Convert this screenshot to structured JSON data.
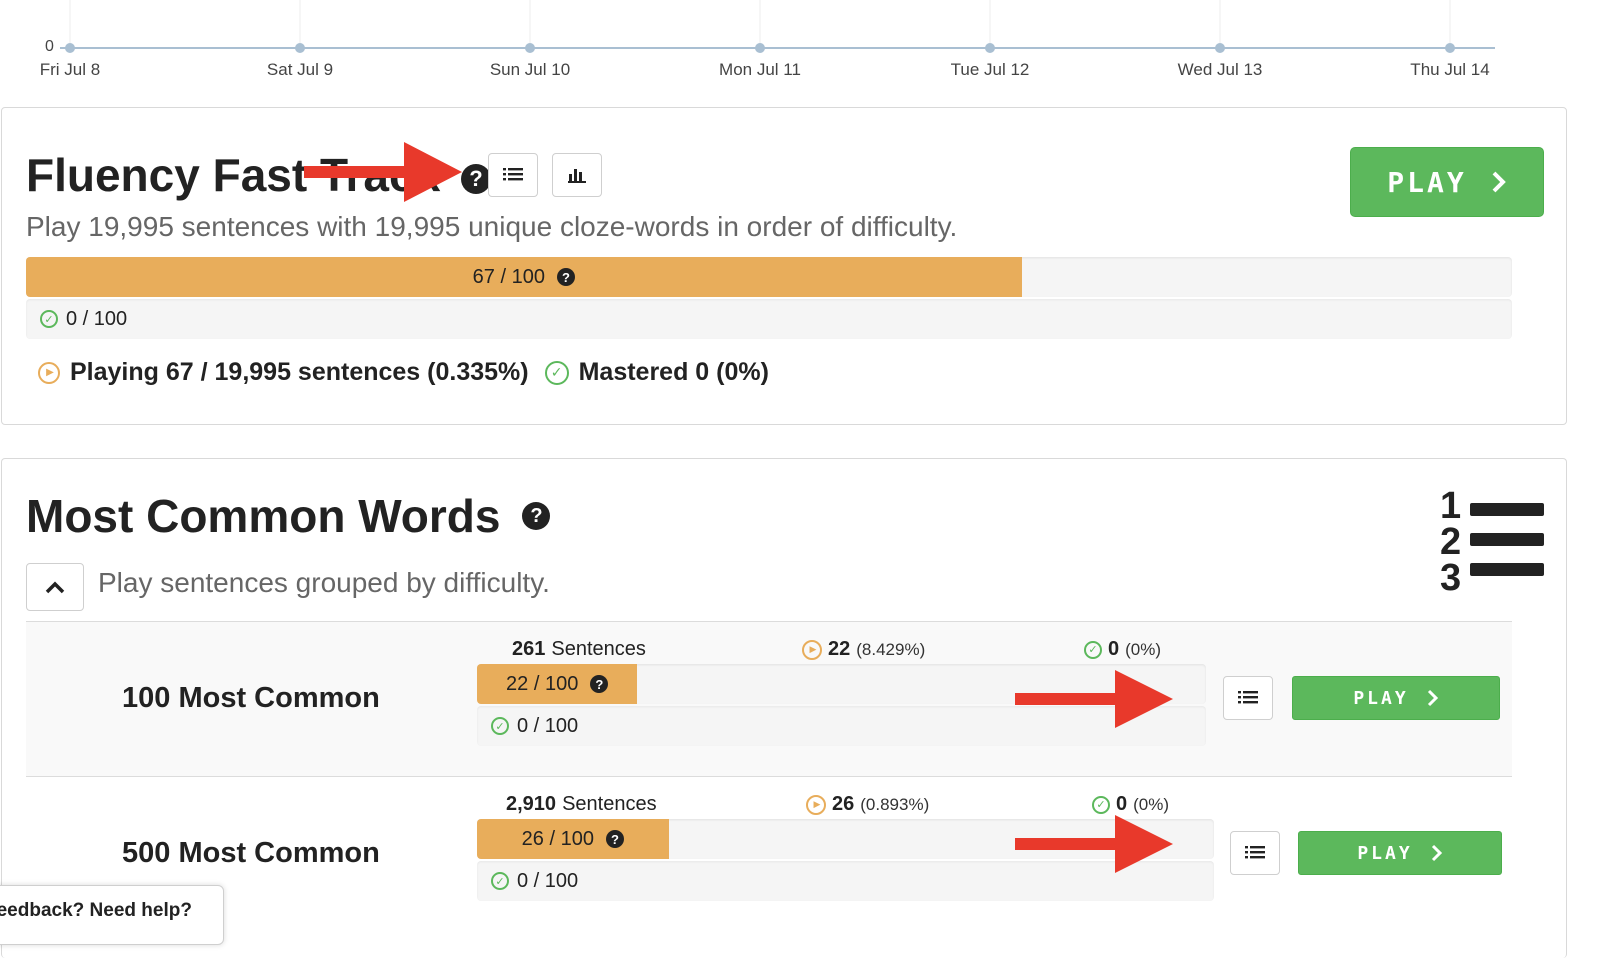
{
  "timeline": {
    "y_zero_label": "0",
    "dates": [
      "Fri Jul 8",
      "Sat Jul 9",
      "Sun Jul 10",
      "Mon Jul 11",
      "Tue Jul 12",
      "Wed Jul 13",
      "Thu Jul 14"
    ]
  },
  "fluency_fast_track": {
    "title": "Fluency Fast Track",
    "help_glyph": "?",
    "description": "Play 19,995 sentences with 19,995 unique cloze-words in order of difficulty.",
    "play_label": "PLAY",
    "progress": {
      "value": 67,
      "max": 100,
      "label": "67 / 100"
    },
    "mastered_progress": {
      "value": 0,
      "max": 100,
      "label": "0 / 100"
    },
    "playing_text": "Playing 67 / 19,995 sentences (0.335%)",
    "mastered_text": "Mastered 0 (0%)"
  },
  "most_common_words": {
    "title": "Most Common Words",
    "help_glyph": "?",
    "description": "Play sentences grouped by difficulty.",
    "list_numbers": [
      "1",
      "2",
      "3"
    ],
    "groups": [
      {
        "name": "100 Most Common",
        "sentences_count": "261",
        "sentences_label": "Sentences",
        "playing_count": "22",
        "playing_pct": "(8.429%)",
        "mastered_count": "0",
        "mastered_pct": "(0%)",
        "progress": {
          "value": 22,
          "max": 100,
          "label": "22 / 100"
        },
        "mastered_progress": {
          "value": 0,
          "max": 100,
          "label": "0 / 100"
        },
        "play_label": "PLAY"
      },
      {
        "name": "500 Most Common",
        "sentences_count": "2,910",
        "sentences_label": "Sentences",
        "playing_count": "26",
        "playing_pct": "(0.893%)",
        "mastered_count": "0",
        "mastered_pct": "(0%)",
        "progress": {
          "value": 26,
          "max": 100,
          "label": "26 / 100"
        },
        "mastered_progress": {
          "value": 0,
          "max": 100,
          "label": "0 / 100"
        },
        "play_label": "PLAY"
      }
    ]
  },
  "feedback": {
    "label": "Feedback? Need help?"
  },
  "colors": {
    "accent_green": "#5cb85c",
    "progress_orange": "#e8ad5b",
    "annotation_red": "#e8392b",
    "timeline_line": "#a9bfd2"
  },
  "icons": [
    "list-icon",
    "bar-chart-icon",
    "chevron-right-icon",
    "chevron-up-icon",
    "help-icon",
    "check-circle-icon",
    "play-circle-icon",
    "numbered-list-icon"
  ]
}
